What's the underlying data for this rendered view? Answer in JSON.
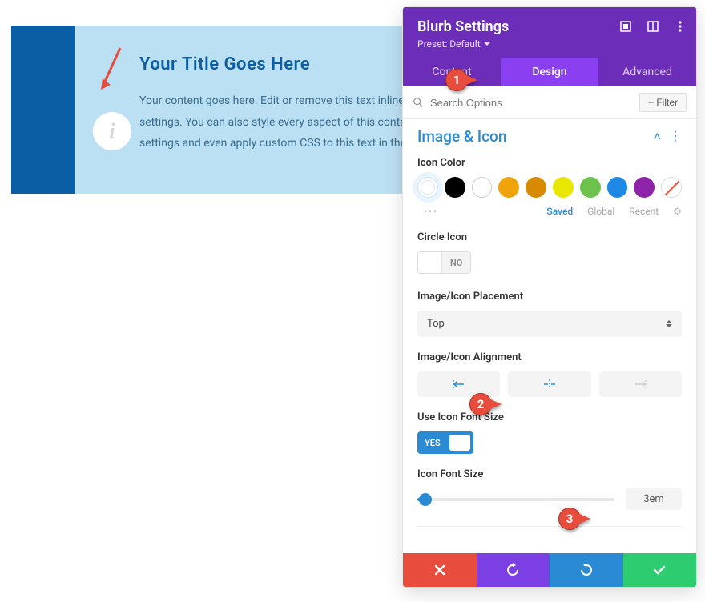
{
  "preview": {
    "title": "Your Title Goes Here",
    "body": "Your content goes here. Edit or remove this text inline or in the module Content settings. You can also style every aspect of this content in the module Design settings and even apply custom CSS to this text in the module Advanced settings.",
    "icon_glyph": "i"
  },
  "panel": {
    "title": "Blurb Settings",
    "preset_label": "Preset: Default",
    "tabs": {
      "content": "Content",
      "design": "Design",
      "advanced": "Advanced"
    },
    "search_placeholder": "Search Options",
    "filter_label": "+ Filter",
    "section_title": "Image & Icon",
    "fields": {
      "icon_color_label": "Icon Color",
      "swatch_tabs": {
        "saved": "Saved",
        "global": "Global",
        "recent": "Recent"
      },
      "circle_icon_label": "Circle Icon",
      "circle_icon_value": "NO",
      "placement_label": "Image/Icon Placement",
      "placement_value": "Top",
      "alignment_label": "Image/Icon Alignment",
      "use_icon_size_label": "Use Icon Font Size",
      "use_icon_size_value": "YES",
      "font_size_label": "Icon Font Size",
      "font_size_value": "3em"
    },
    "colors": {
      "palette": [
        "#000000",
        "#ffffff",
        "#f0a30a",
        "#d88a00",
        "#e9e600",
        "#6cc24a",
        "#1e88e5",
        "#8e24aa"
      ]
    }
  },
  "annotations": {
    "pin1": "1",
    "pin2": "2",
    "pin3": "3"
  }
}
